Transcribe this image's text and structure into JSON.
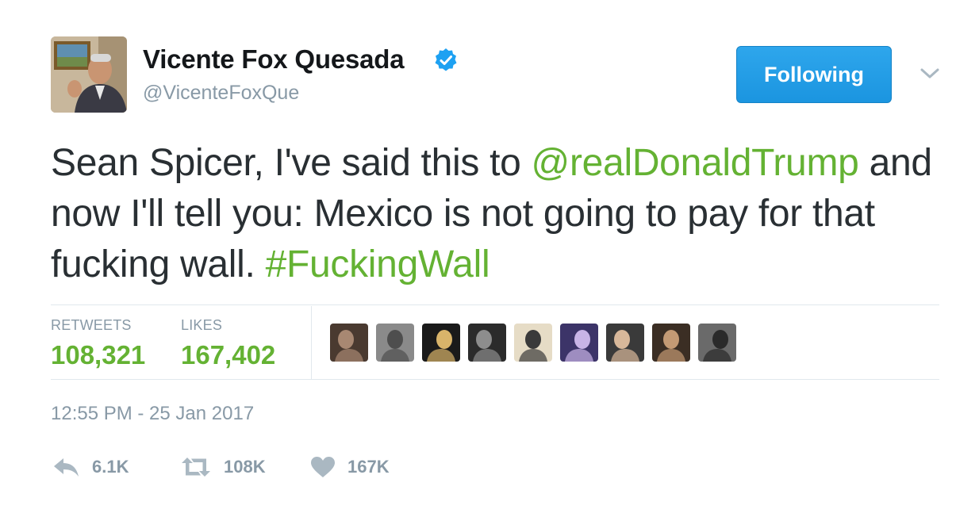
{
  "author": {
    "name": "Vicente Fox Quesada",
    "handle": "@VicenteFoxQue",
    "verified": true,
    "avatar_icon": "profile-photo"
  },
  "follow_button": {
    "label": "Following"
  },
  "more_menu_icon": "chevron-down-icon",
  "tweet": {
    "text_before_mention": "Sean Spicer, I've said this to ",
    "mention": "@realDonaldTrump",
    "text_after_mention": " and now I'll tell you: Mexico is not going to pay for that fucking wall. ",
    "hashtag": "#FuckingWall"
  },
  "stats": {
    "retweets_label": "RETWEETS",
    "retweets_value": "108,321",
    "likes_label": "LIKES",
    "likes_value": "167,402"
  },
  "likers": [
    {
      "name": "liker-avatar-1",
      "colors": [
        "#4a3a30",
        "#a88872"
      ]
    },
    {
      "name": "liker-avatar-2",
      "colors": [
        "#8a8a8a",
        "#4e4e4e"
      ]
    },
    {
      "name": "liker-avatar-3",
      "colors": [
        "#1a1a1a",
        "#d9b46a"
      ]
    },
    {
      "name": "liker-avatar-4",
      "colors": [
        "#2b2b2b",
        "#8d8d8d"
      ]
    },
    {
      "name": "liker-avatar-5",
      "colors": [
        "#e6dcc6",
        "#3a3a3a"
      ]
    },
    {
      "name": "liker-avatar-6",
      "colors": [
        "#3c3468",
        "#c8b4e6"
      ]
    },
    {
      "name": "liker-avatar-7",
      "colors": [
        "#3a3a3a",
        "#d8b89a"
      ]
    },
    {
      "name": "liker-avatar-8",
      "colors": [
        "#3b2e24",
        "#c49a74"
      ]
    },
    {
      "name": "liker-avatar-9",
      "colors": [
        "#6a6a6a",
        "#2a2a2a"
      ]
    }
  ],
  "timestamp": "12:55 PM - 25 Jan 2017",
  "actions": {
    "reply_count": "6.1K",
    "retweet_count": "108K",
    "like_count": "167K"
  },
  "colors": {
    "accent_green": "#64b233",
    "follow_blue": "#1da1f2",
    "verified_blue": "#1da1f2",
    "muted_gray": "#8899a6",
    "divider": "#e1e8ed"
  }
}
